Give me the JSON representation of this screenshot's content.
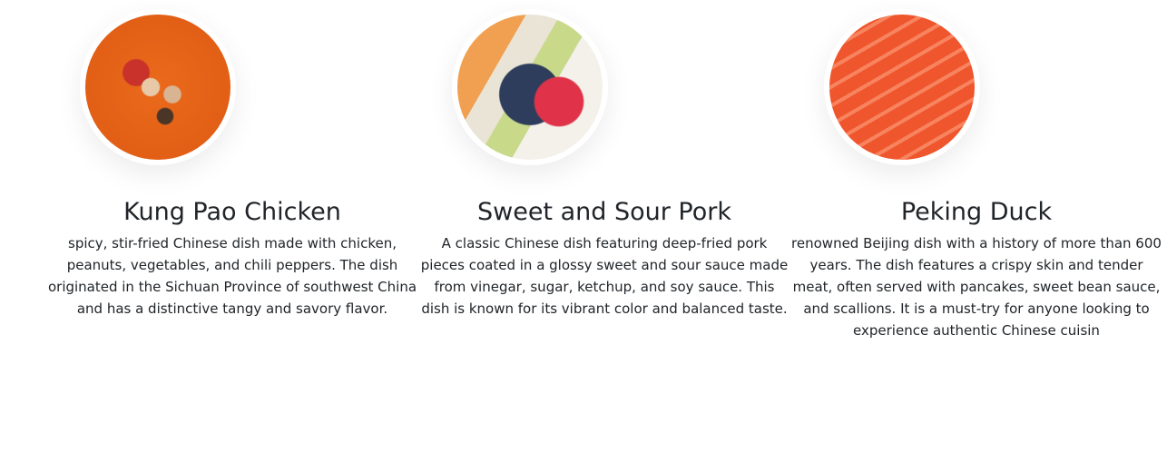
{
  "cards": [
    {
      "title": "Kung Pao Chicken",
      "image": "kung-pao-chicken-photo",
      "description": "spicy, stir-fried Chinese dish made with chicken, peanuts, vegetables, and chili peppers. The dish originated in the Sichuan Province of southwest China and has a distinctive tangy and savory flavor."
    },
    {
      "title": "Sweet and Sour Pork",
      "image": "fruit-photo",
      "description": "A classic Chinese dish featuring deep-fried pork pieces coated in a glossy sweet and sour sauce made from vinegar, sugar, ketchup, and soy sauce. This dish is known for its vibrant color and balanced taste."
    },
    {
      "title": "Peking Duck",
      "image": "salmon-photo",
      "description": "renowned Beijing dish with a history of more than 600 years. The dish features a crispy skin and tender meat, often served with pancakes, sweet bean sauce, and scallions. It is a must-try for anyone looking to experience authentic Chinese cuisin"
    }
  ]
}
